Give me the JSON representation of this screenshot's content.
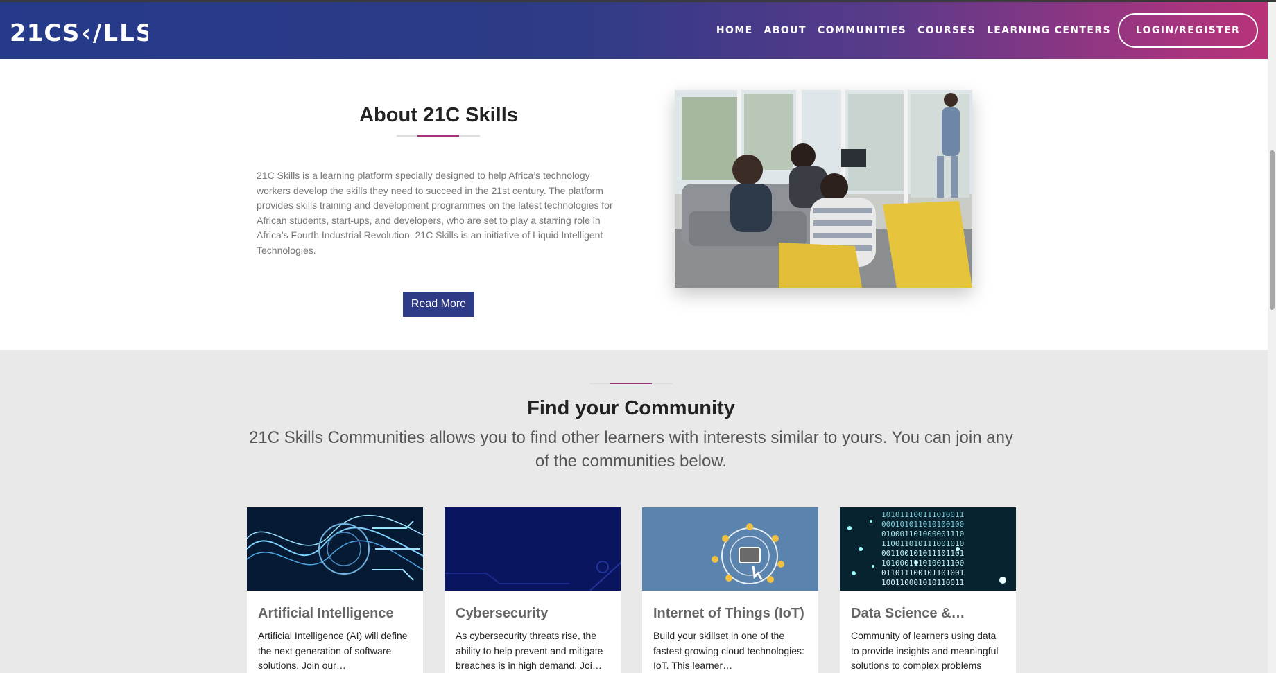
{
  "header": {
    "logo": "21CSKILLS",
    "nav": [
      "HOME",
      "ABOUT",
      "COMMUNITIES",
      "COURSES",
      "LEARNING CENTERS"
    ],
    "login": "LOGIN/REGISTER"
  },
  "about": {
    "title": "About 21C Skills",
    "text": "21C Skills is a learning platform specially designed to help Africa’s technology workers develop the skills they need to succeed in the 21st century. The platform provides skills training and development programmes on the latest technologies for African students, start-ups, and developers, who are set to play a starring role in Africa’s Fourth Industrial Revolution. 21C Skills is an initiative of Liquid Intelligent Technologies.",
    "button": "Read More"
  },
  "community": {
    "title": "Find your Community",
    "subtitle": "21C Skills Communities allows you to find other learners with interests similar to yours. You can join any of the communities below.",
    "cards": [
      {
        "title": "Artificial Intelligence",
        "desc": "Artificial Intelligence (AI) will define the next generation of software solutions. Join our…"
      },
      {
        "title": "Cybersecurity",
        "desc": "As cybersecurity threats rise, the ability to help prevent and mitigate breaches is in high demand. Joi…"
      },
      {
        "title": "Internet of Things (IoT)",
        "desc": "Build your skillset in one of the fastest growing cloud technologies: IoT. This learner…"
      },
      {
        "title": "Data Science &…",
        "desc": "Community of learners using data to provide insights and meaningful solutions to complex problems"
      }
    ]
  },
  "colors": {
    "brand_blue": "#2e3b86",
    "brand_magenta": "#a3347f"
  }
}
